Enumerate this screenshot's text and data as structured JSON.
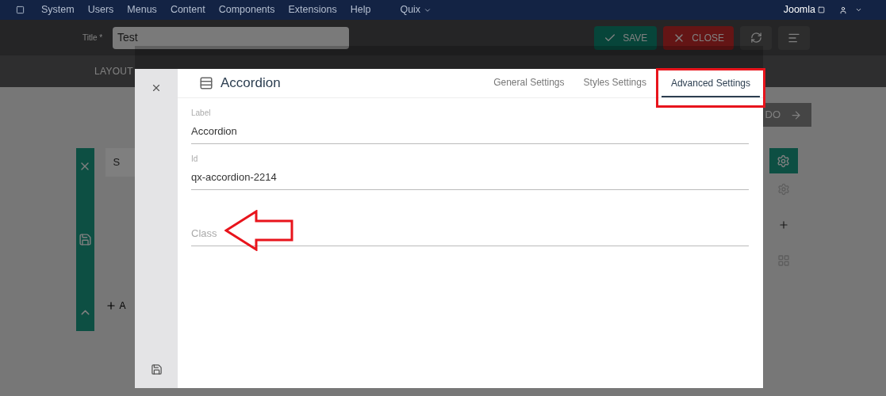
{
  "nav": {
    "menu": [
      {
        "label": "System"
      },
      {
        "label": "Users"
      },
      {
        "label": "Menus"
      },
      {
        "label": "Content"
      },
      {
        "label": "Components"
      },
      {
        "label": "Extensions"
      },
      {
        "label": "Help"
      },
      {
        "label": "Quix",
        "dropdown": true
      }
    ],
    "user": "Joomla"
  },
  "toolbar": {
    "title_label": "Title *",
    "title_value": "Test",
    "buttons": [
      {
        "kind": "save",
        "label": "SAVE"
      },
      {
        "kind": "close",
        "label": "CLOSE"
      },
      {
        "kind": "refresh"
      },
      {
        "kind": "menu"
      }
    ]
  },
  "builder": {
    "tab": "LAYOUT",
    "next_button": "DO",
    "section_text": "S",
    "row_text": "A"
  },
  "dialog": {
    "title": "Accordion",
    "tabs": [
      {
        "label": "General Settings",
        "selected": false
      },
      {
        "label": "Styles Settings",
        "selected": false
      },
      {
        "label": "Advanced Settings",
        "selected": true
      }
    ],
    "fields": [
      {
        "label": "Label",
        "value": "Accordion"
      },
      {
        "label": "Id",
        "value": "qx-accordion-2214"
      },
      {
        "placeholder": "Class"
      }
    ]
  }
}
